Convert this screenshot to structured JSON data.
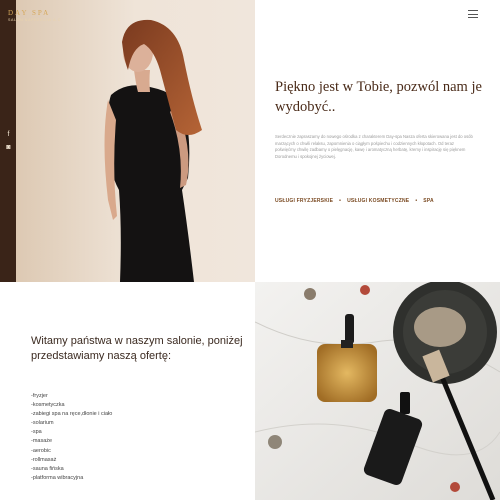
{
  "brand": {
    "name": "DAY SPA",
    "subtitle": "SALON NAPRZECIW A.C"
  },
  "social": {
    "facebook": "f",
    "instagram": "◙"
  },
  "hero": {
    "title": "Piękno jest w Tobie, pozwól nam je wydobyć..",
    "text": "Serdecznie zapraszamy do nowego ośrodka z charakterem Day-spa Nasza oferta skierowana jest do osób marzących o chwili relaksu, zapomnienia o ciągłym pośpiechu i codziennych kłopotach. Od teraz poświęćmy chwilę zadbamy o pielęgnację, kawę i aromatyczną herbatę, kremy i inspirację się pięknem Dorodnemu i spokojnej życiowej.",
    "services": [
      "USŁUGI FRYZJERSKIE",
      "USŁUGI KOSMETYCZNE",
      "SPA"
    ]
  },
  "welcome": {
    "heading": "Witamy państwa w naszym salonie, poniżej przedstawiamy naszą ofertę:",
    "items": [
      "-fryzjer",
      "-kosmetyczka",
      "-zabiegi spa na ręce,dłonie i ciało",
      "-solarium",
      "-spa",
      "-masaże",
      "-aerobic",
      "-rollmasaż",
      "-sauna fińska",
      "-platforma wibracyjna"
    ]
  },
  "colors": {
    "sidebar": "#3a2418",
    "accent": "#7a4a22",
    "gold": "#d6a85a"
  },
  "icons": {
    "menu": "hamburger-menu-icon",
    "facebook": "facebook-icon",
    "instagram": "instagram-icon"
  }
}
